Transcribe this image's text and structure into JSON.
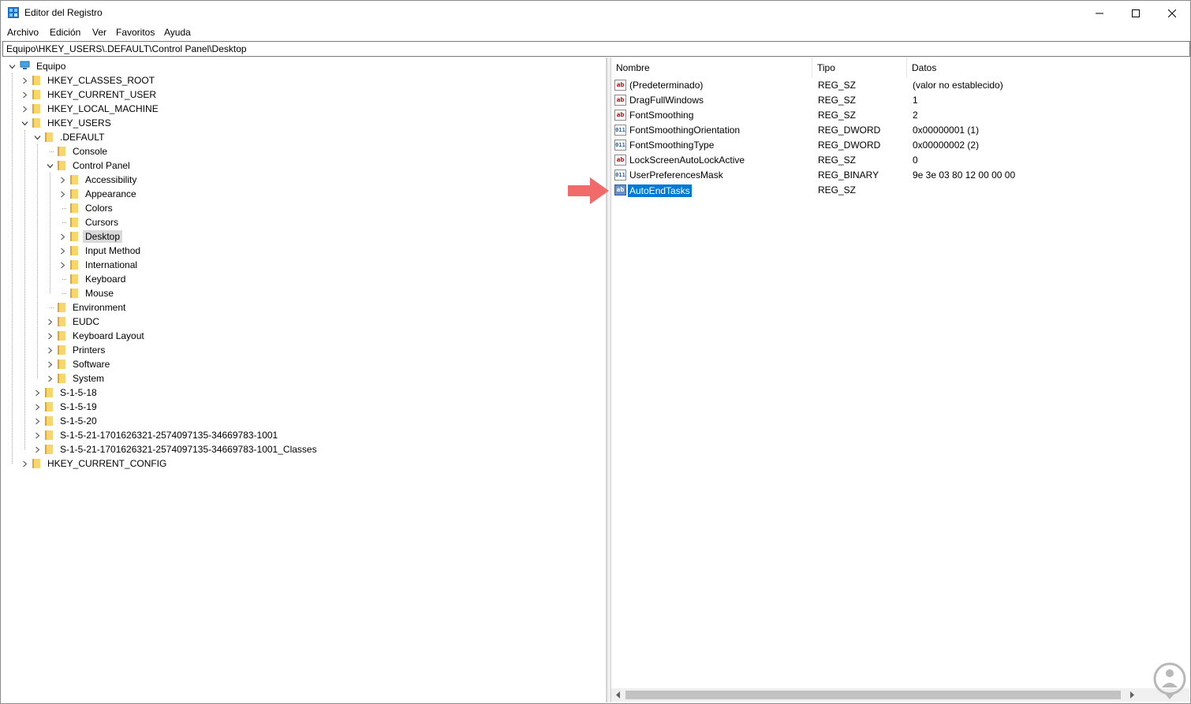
{
  "window": {
    "title": "Editor del Registro"
  },
  "menu": [
    "Archivo",
    "Edición",
    "Ver",
    "Favoritos",
    "Ayuda"
  ],
  "address": "Equipo\\HKEY_USERS\\.DEFAULT\\Control Panel\\Desktop",
  "tree": [
    {
      "label": "Equipo",
      "level": 0,
      "expander": "open",
      "icon": "computer-icon"
    },
    {
      "label": "HKEY_CLASSES_ROOT",
      "level": 1,
      "expander": "closed"
    },
    {
      "label": "HKEY_CURRENT_USER",
      "level": 1,
      "expander": "closed"
    },
    {
      "label": "HKEY_LOCAL_MACHINE",
      "level": 1,
      "expander": "closed"
    },
    {
      "label": "HKEY_USERS",
      "level": 1,
      "expander": "open"
    },
    {
      "label": ".DEFAULT",
      "level": 2,
      "expander": "open"
    },
    {
      "label": "Console",
      "level": 3,
      "expander": "none"
    },
    {
      "label": "Control Panel",
      "level": 3,
      "expander": "open"
    },
    {
      "label": "Accessibility",
      "level": 4,
      "expander": "closed"
    },
    {
      "label": "Appearance",
      "level": 4,
      "expander": "closed"
    },
    {
      "label": "Colors",
      "level": 4,
      "expander": "none"
    },
    {
      "label": "Cursors",
      "level": 4,
      "expander": "none"
    },
    {
      "label": "Desktop",
      "level": 4,
      "expander": "closed",
      "selected": true
    },
    {
      "label": "Input Method",
      "level": 4,
      "expander": "closed"
    },
    {
      "label": "International",
      "level": 4,
      "expander": "closed"
    },
    {
      "label": "Keyboard",
      "level": 4,
      "expander": "none"
    },
    {
      "label": "Mouse",
      "level": 4,
      "expander": "none"
    },
    {
      "label": "Environment",
      "level": 3,
      "expander": "none"
    },
    {
      "label": "EUDC",
      "level": 3,
      "expander": "closed"
    },
    {
      "label": "Keyboard Layout",
      "level": 3,
      "expander": "closed"
    },
    {
      "label": "Printers",
      "level": 3,
      "expander": "closed"
    },
    {
      "label": "Software",
      "level": 3,
      "expander": "closed"
    },
    {
      "label": "System",
      "level": 3,
      "expander": "closed"
    },
    {
      "label": "S-1-5-18",
      "level": 2,
      "expander": "closed"
    },
    {
      "label": "S-1-5-19",
      "level": 2,
      "expander": "closed"
    },
    {
      "label": "S-1-5-20",
      "level": 2,
      "expander": "closed"
    },
    {
      "label": "S-1-5-21-1701626321-2574097135-34669783-1001",
      "level": 2,
      "expander": "closed"
    },
    {
      "label": "S-1-5-21-1701626321-2574097135-34669783-1001_Classes",
      "level": 2,
      "expander": "closed"
    },
    {
      "label": "HKEY_CURRENT_CONFIG",
      "level": 1,
      "expander": "closed"
    }
  ],
  "list": {
    "headers": [
      "Nombre",
      "Tipo",
      "Datos"
    ],
    "rows": [
      {
        "name": "(Predeterminado)",
        "type": "REG_SZ",
        "data": "(valor no establecido)",
        "icon": "string-value-icon"
      },
      {
        "name": "DragFullWindows",
        "type": "REG_SZ",
        "data": "1",
        "icon": "string-value-icon"
      },
      {
        "name": "FontSmoothing",
        "type": "REG_SZ",
        "data": "2",
        "icon": "string-value-icon"
      },
      {
        "name": "FontSmoothingOrientation",
        "type": "REG_DWORD",
        "data": "0x00000001 (1)",
        "icon": "binary-value-icon"
      },
      {
        "name": "FontSmoothingType",
        "type": "REG_DWORD",
        "data": "0x00000002 (2)",
        "icon": "binary-value-icon"
      },
      {
        "name": "LockScreenAutoLockActive",
        "type": "REG_SZ",
        "data": "0",
        "icon": "string-value-icon"
      },
      {
        "name": "UserPreferencesMask",
        "type": "REG_BINARY",
        "data": "9e 3e 03 80 12 00 00 00",
        "icon": "binary-value-icon"
      },
      {
        "name": "AutoEndTasks",
        "type": "REG_SZ",
        "data": "",
        "icon": "string-value-icon",
        "selected": true
      }
    ]
  },
  "colors": {
    "selection": "#0078d7",
    "annotation_arrow": "#f26b6b",
    "folder": "#f8d66f"
  }
}
